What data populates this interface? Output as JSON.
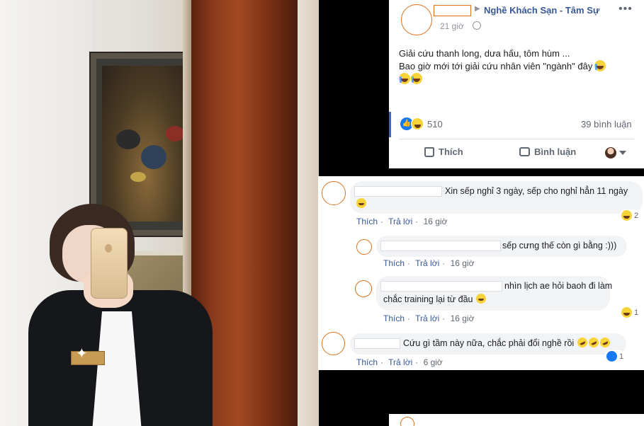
{
  "post": {
    "group_name": "Nghề Khách Sạn - Tâm Sự",
    "time": "21 giờ",
    "body_line1": "Giải cứu thanh long, dưa hấu, tôm hùm ...",
    "body_line2": "Bao giờ mới tới giải cứu nhân viên \"ngành\" đây",
    "reaction_count": "510",
    "comment_count": "39 bình luận",
    "like_label": "Thích",
    "comment_label": "Bình luận",
    "more_icon": "more-dots-icon",
    "globe_icon": "globe-icon"
  },
  "comments": [
    {
      "text_line1": "Xin sếp nghỉ 3 ngày, sếp cho nghỉ hẳn 11 ngày",
      "like": "Thích",
      "reply": "Trả lời",
      "time": "16 giờ",
      "reaction_count": "2"
    },
    {
      "text": "sếp cưng thế còn gì bằng :)))",
      "like": "Thích",
      "reply": "Trả lời",
      "time": "16 giờ"
    },
    {
      "text_line1": "nhìn lịch ae hỏi baoh đi làm",
      "text_line2": "chắc training lại từ đầu",
      "like": "Thích",
      "reply": "Trả lời",
      "time": "16 giờ",
      "reaction_count": "1"
    },
    {
      "text": "Cứu gì tầm này nữa, chắc phải đổi nghề rồi",
      "like": "Thích",
      "reply": "Trả lời",
      "time": "6 giờ",
      "reaction_count": "1"
    }
  ],
  "colors": {
    "link_blue": "#385898",
    "like_blue": "#1877f2",
    "redaction_orange": "#d9731f"
  }
}
